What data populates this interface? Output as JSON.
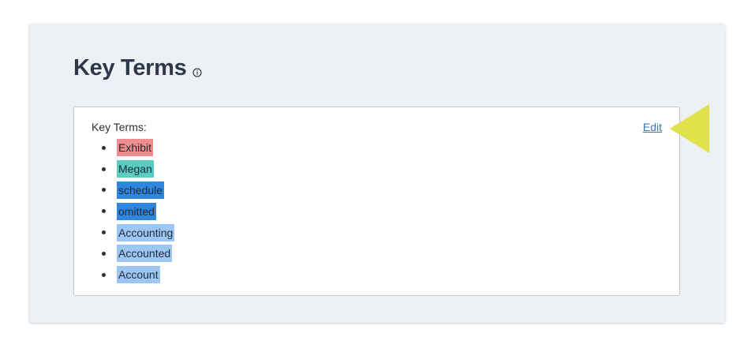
{
  "section": {
    "title": "Key Terms",
    "info_icon": "info-circle-icon"
  },
  "card": {
    "label": "Key Terms:",
    "edit_label": "Edit"
  },
  "terms": [
    {
      "text": "Exhibit",
      "highlight": "#ee8d8b"
    },
    {
      "text": "Megan",
      "highlight": "#5ccbc0"
    },
    {
      "text": "schedule",
      "highlight": "#2e86de"
    },
    {
      "text": "omitted",
      "highlight": "#2e86de"
    },
    {
      "text": "Accounting",
      "highlight": "#9cc7f4"
    },
    {
      "text": "Accounted",
      "highlight": "#9cc7f4"
    },
    {
      "text": "Account",
      "highlight": "#9cc7f4"
    }
  ],
  "annotation": {
    "arrow_color": "#dfe24a"
  }
}
